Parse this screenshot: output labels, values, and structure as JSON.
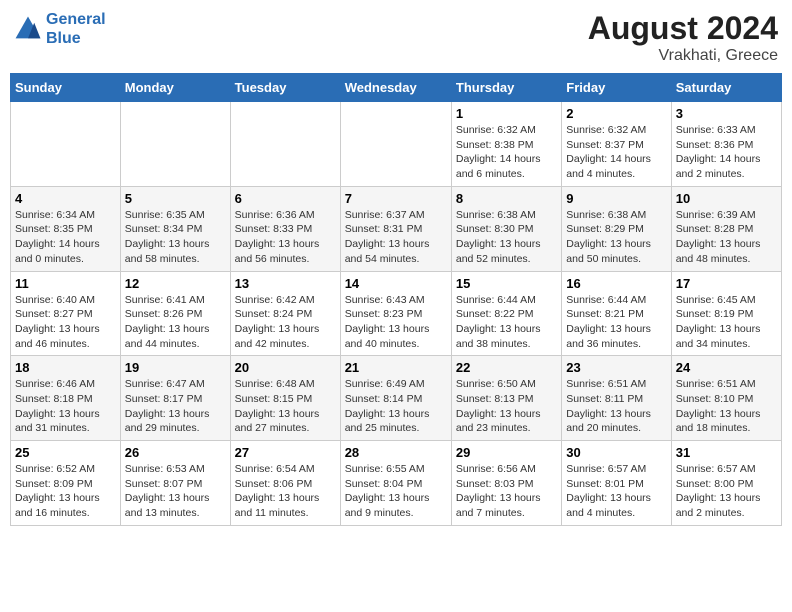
{
  "header": {
    "logo_line1": "General",
    "logo_line2": "Blue",
    "month_year": "August 2024",
    "location": "Vrakhati, Greece"
  },
  "days_of_week": [
    "Sunday",
    "Monday",
    "Tuesday",
    "Wednesday",
    "Thursday",
    "Friday",
    "Saturday"
  ],
  "weeks": [
    [
      {
        "day": "",
        "info": ""
      },
      {
        "day": "",
        "info": ""
      },
      {
        "day": "",
        "info": ""
      },
      {
        "day": "",
        "info": ""
      },
      {
        "day": "1",
        "info": "Sunrise: 6:32 AM\nSunset: 8:38 PM\nDaylight: 14 hours and 6 minutes."
      },
      {
        "day": "2",
        "info": "Sunrise: 6:32 AM\nSunset: 8:37 PM\nDaylight: 14 hours and 4 minutes."
      },
      {
        "day": "3",
        "info": "Sunrise: 6:33 AM\nSunset: 8:36 PM\nDaylight: 14 hours and 2 minutes."
      }
    ],
    [
      {
        "day": "4",
        "info": "Sunrise: 6:34 AM\nSunset: 8:35 PM\nDaylight: 14 hours and 0 minutes."
      },
      {
        "day": "5",
        "info": "Sunrise: 6:35 AM\nSunset: 8:34 PM\nDaylight: 13 hours and 58 minutes."
      },
      {
        "day": "6",
        "info": "Sunrise: 6:36 AM\nSunset: 8:33 PM\nDaylight: 13 hours and 56 minutes."
      },
      {
        "day": "7",
        "info": "Sunrise: 6:37 AM\nSunset: 8:31 PM\nDaylight: 13 hours and 54 minutes."
      },
      {
        "day": "8",
        "info": "Sunrise: 6:38 AM\nSunset: 8:30 PM\nDaylight: 13 hours and 52 minutes."
      },
      {
        "day": "9",
        "info": "Sunrise: 6:38 AM\nSunset: 8:29 PM\nDaylight: 13 hours and 50 minutes."
      },
      {
        "day": "10",
        "info": "Sunrise: 6:39 AM\nSunset: 8:28 PM\nDaylight: 13 hours and 48 minutes."
      }
    ],
    [
      {
        "day": "11",
        "info": "Sunrise: 6:40 AM\nSunset: 8:27 PM\nDaylight: 13 hours and 46 minutes."
      },
      {
        "day": "12",
        "info": "Sunrise: 6:41 AM\nSunset: 8:26 PM\nDaylight: 13 hours and 44 minutes."
      },
      {
        "day": "13",
        "info": "Sunrise: 6:42 AM\nSunset: 8:24 PM\nDaylight: 13 hours and 42 minutes."
      },
      {
        "day": "14",
        "info": "Sunrise: 6:43 AM\nSunset: 8:23 PM\nDaylight: 13 hours and 40 minutes."
      },
      {
        "day": "15",
        "info": "Sunrise: 6:44 AM\nSunset: 8:22 PM\nDaylight: 13 hours and 38 minutes."
      },
      {
        "day": "16",
        "info": "Sunrise: 6:44 AM\nSunset: 8:21 PM\nDaylight: 13 hours and 36 minutes."
      },
      {
        "day": "17",
        "info": "Sunrise: 6:45 AM\nSunset: 8:19 PM\nDaylight: 13 hours and 34 minutes."
      }
    ],
    [
      {
        "day": "18",
        "info": "Sunrise: 6:46 AM\nSunset: 8:18 PM\nDaylight: 13 hours and 31 minutes."
      },
      {
        "day": "19",
        "info": "Sunrise: 6:47 AM\nSunset: 8:17 PM\nDaylight: 13 hours and 29 minutes."
      },
      {
        "day": "20",
        "info": "Sunrise: 6:48 AM\nSunset: 8:15 PM\nDaylight: 13 hours and 27 minutes."
      },
      {
        "day": "21",
        "info": "Sunrise: 6:49 AM\nSunset: 8:14 PM\nDaylight: 13 hours and 25 minutes."
      },
      {
        "day": "22",
        "info": "Sunrise: 6:50 AM\nSunset: 8:13 PM\nDaylight: 13 hours and 23 minutes."
      },
      {
        "day": "23",
        "info": "Sunrise: 6:51 AM\nSunset: 8:11 PM\nDaylight: 13 hours and 20 minutes."
      },
      {
        "day": "24",
        "info": "Sunrise: 6:51 AM\nSunset: 8:10 PM\nDaylight: 13 hours and 18 minutes."
      }
    ],
    [
      {
        "day": "25",
        "info": "Sunrise: 6:52 AM\nSunset: 8:09 PM\nDaylight: 13 hours and 16 minutes."
      },
      {
        "day": "26",
        "info": "Sunrise: 6:53 AM\nSunset: 8:07 PM\nDaylight: 13 hours and 13 minutes."
      },
      {
        "day": "27",
        "info": "Sunrise: 6:54 AM\nSunset: 8:06 PM\nDaylight: 13 hours and 11 minutes."
      },
      {
        "day": "28",
        "info": "Sunrise: 6:55 AM\nSunset: 8:04 PM\nDaylight: 13 hours and 9 minutes."
      },
      {
        "day": "29",
        "info": "Sunrise: 6:56 AM\nSunset: 8:03 PM\nDaylight: 13 hours and 7 minutes."
      },
      {
        "day": "30",
        "info": "Sunrise: 6:57 AM\nSunset: 8:01 PM\nDaylight: 13 hours and 4 minutes."
      },
      {
        "day": "31",
        "info": "Sunrise: 6:57 AM\nSunset: 8:00 PM\nDaylight: 13 hours and 2 minutes."
      }
    ]
  ]
}
